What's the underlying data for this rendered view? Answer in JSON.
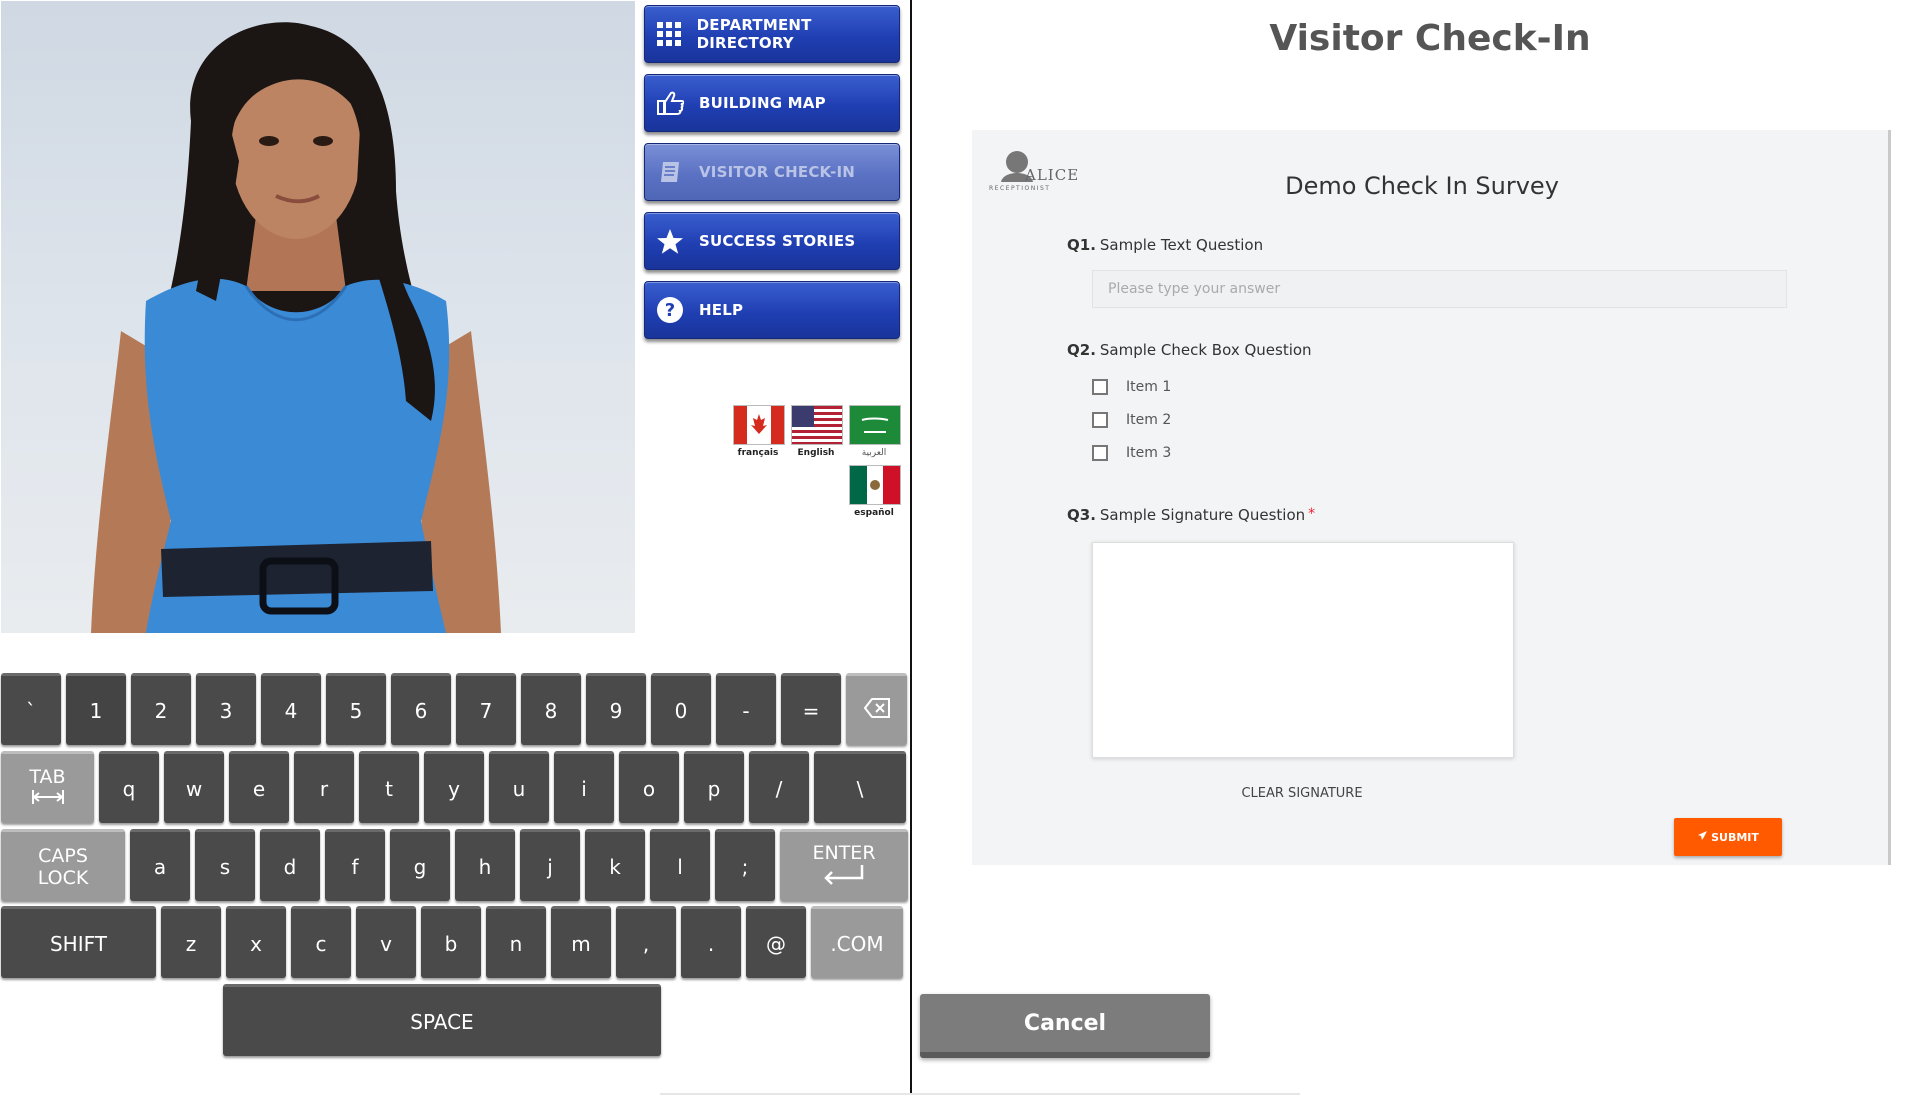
{
  "menu": {
    "items": [
      {
        "label": "DEPARTMENT DIRECTORY",
        "icon": "grid-icon"
      },
      {
        "label": "BUILDING MAP",
        "icon": "thumbs-pointing-icon"
      },
      {
        "label": "VISITOR CHECK-IN",
        "icon": "book-icon",
        "disabled": true
      },
      {
        "label": "SUCCESS STORIES",
        "icon": "star-icon"
      },
      {
        "label": "HELP",
        "icon": "question-icon"
      }
    ]
  },
  "languages": [
    {
      "label": "français",
      "flag": "canada"
    },
    {
      "label": "English",
      "flag": "usa"
    },
    {
      "label": "العربية",
      "flag": "saudi-arabia"
    },
    {
      "label": "español",
      "flag": "mexico"
    }
  ],
  "keyboard": {
    "row1": [
      "`",
      "1",
      "2",
      "3",
      "4",
      "5",
      "6",
      "7",
      "8",
      "9",
      "0",
      "-",
      "="
    ],
    "row2": [
      "q",
      "w",
      "e",
      "r",
      "t",
      "y",
      "u",
      "i",
      "o",
      "p",
      "/",
      "\\"
    ],
    "row3": [
      "a",
      "s",
      "d",
      "f",
      "g",
      "h",
      "j",
      "k",
      "l",
      ";"
    ],
    "row4": [
      "z",
      "x",
      "c",
      "v",
      "b",
      "n",
      "m",
      ",",
      ".",
      "@"
    ],
    "tab": "TAB",
    "caps_line1": "CAPS",
    "caps_line2": "LOCK",
    "enter": "ENTER",
    "shift": "SHIFT",
    "com": ".COM",
    "space": "SPACE"
  },
  "page": {
    "title": "Visitor Check-In"
  },
  "survey": {
    "logo_text": "ALICE",
    "logo_sub": "RECEPTIONIST",
    "title": "Demo Check In Survey",
    "q1": {
      "num": "Q1.",
      "text": "Sample Text Question",
      "placeholder": "Please type your answer"
    },
    "q2": {
      "num": "Q2.",
      "text": "Sample Check Box Question",
      "items": [
        "Item 1",
        "Item 2",
        "Item 3"
      ]
    },
    "q3": {
      "num": "Q3.",
      "text": "Sample Signature Question",
      "required_mark": "*"
    },
    "clear_signature": "CLEAR SIGNATURE",
    "submit": "SUBMIT"
  },
  "cancel": "Cancel",
  "colors": {
    "menu_blue": "#1f3fb3",
    "submit_orange": "#ff5a00",
    "key_dark": "#4a4a4a",
    "cancel_gray": "#7c7c7c"
  }
}
